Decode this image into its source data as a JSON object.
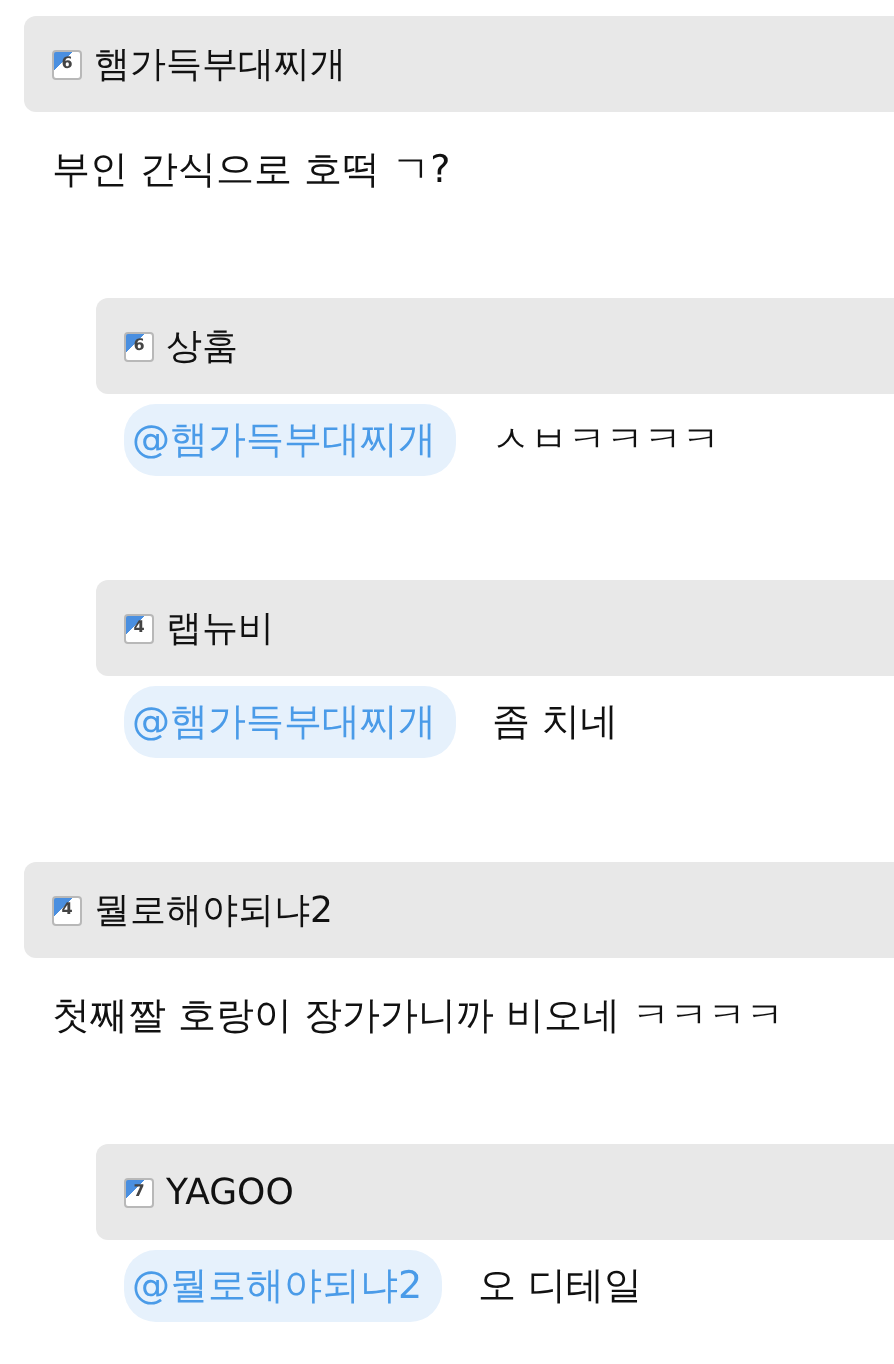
{
  "comments": [
    {
      "author": "햄가득부대찌개",
      "level": "6",
      "text": "부인 간식으로 호떡 ㄱ?",
      "replies": [
        {
          "author": "상훔",
          "level": "6",
          "mention": "@햄가득부대찌개",
          "text": "ㅅㅂㅋㅋㅋㅋ"
        },
        {
          "author": "랩뉴비",
          "level": "4",
          "mention": "@햄가득부대찌개",
          "text": "좀 치네"
        }
      ]
    },
    {
      "author": "뭘로해야되냐2",
      "level": "4",
      "text": "첫째짤 호랑이 장가가니까 비오네 ㅋㅋㅋㅋ",
      "replies": [
        {
          "author": "YAGOO",
          "level": "7",
          "mention": "@뭘로해야되냐2",
          "text": "오 디테일"
        }
      ]
    }
  ]
}
